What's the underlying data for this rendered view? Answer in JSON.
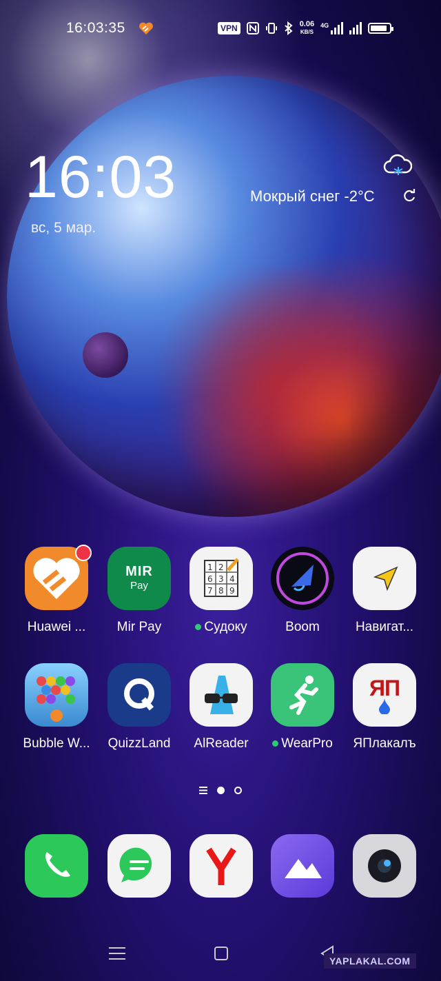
{
  "status_bar": {
    "time": "16:03:35",
    "vpn": "VPN",
    "net_speed_value": "0.06",
    "net_speed_unit": "KB/S",
    "network_type": "4G",
    "battery_level": 0.9
  },
  "clock_widget": {
    "time": "16:03",
    "date": "вс, 5 мар.",
    "weather": "Мокрый снег -2°C",
    "weather_icon": "cloud-snow-icon"
  },
  "apps_row1": [
    {
      "label": "Huawei ...",
      "icon": "huawei-health-icon",
      "color": "#f08a2b",
      "badge": true,
      "new_dot": false
    },
    {
      "label": "Mir Pay",
      "icon": "mir-pay-icon",
      "color": "#0f8a4a",
      "badge": false,
      "new_dot": false,
      "logo_text": "MIR",
      "logo_sub": "Pay"
    },
    {
      "label": "Судоку",
      "icon": "sudoku-icon",
      "color": "#f3f3f3",
      "badge": false,
      "new_dot": true
    },
    {
      "label": "Boom",
      "icon": "boom-icon",
      "color": "#0a0a14",
      "badge": false,
      "new_dot": false
    },
    {
      "label": "Навигат...",
      "icon": "navigator-icon",
      "color": "#f3f3f3",
      "badge": false,
      "new_dot": false
    }
  ],
  "apps_row2": [
    {
      "label": "Bubble W...",
      "icon": "bubble-shooter-icon",
      "color": "#5ab0e8",
      "new_dot": false
    },
    {
      "label": "QuizzLand",
      "icon": "quizzland-icon",
      "color": "#1a3a8a",
      "new_dot": false
    },
    {
      "label": "AlReader",
      "icon": "alreader-icon",
      "color": "#f3f3f3",
      "new_dot": false
    },
    {
      "label": "WearPro",
      "icon": "wearpro-icon",
      "color": "#3ac47a",
      "new_dot": true
    },
    {
      "label": "ЯПлакалъ",
      "icon": "yaplakal-icon",
      "color": "#f3f3f3",
      "new_dot": false,
      "logo_text": "ЯП"
    }
  ],
  "dock": [
    {
      "name": "phone",
      "icon": "phone-icon",
      "color": "#2dc85a"
    },
    {
      "name": "messages",
      "icon": "messages-icon",
      "color": "#f3f3f3"
    },
    {
      "name": "yandex-browser",
      "icon": "yandex-icon",
      "color": "#f3f3f3"
    },
    {
      "name": "gallery",
      "icon": "gallery-icon",
      "color": "#7a5ae8"
    },
    {
      "name": "camera",
      "icon": "camera-icon",
      "color": "#d8d8dc"
    }
  ],
  "pager": {
    "pages": 2,
    "current": 1
  },
  "watermark": "YAPLAKAL.COM"
}
